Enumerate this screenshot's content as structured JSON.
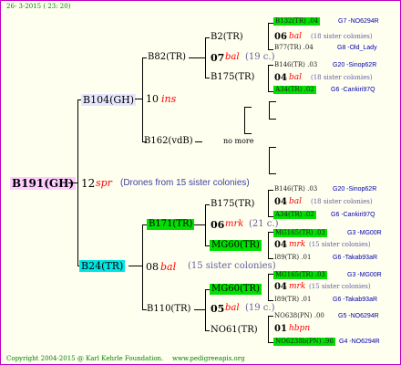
{
  "header": {
    "date": "26- 3-2015 ( 23: 20)"
  },
  "footer": {
    "copyright": "Copyright 2004-2015 @ Karl Kehrle Foundation.",
    "url": "www.pedigreeapis.org"
  },
  "root": {
    "name": "B191(GH)",
    "num": "12",
    "code": "spr",
    "note": "(Drones from 15 sister colonies)"
  },
  "sire": {
    "name": "B104(GH)",
    "num": "10",
    "code": "ins"
  },
  "sire_sire": {
    "name": "B82(TR)"
  },
  "b2": {
    "name": "B2(TR)",
    "num": "07",
    "code": "bal",
    "note": "(19 c.)"
  },
  "b175a": {
    "name": "B175(TR)"
  },
  "b162": {
    "name": "B162(vdB)",
    "note": "no more"
  },
  "dam": {
    "name": "B24(TR)",
    "num": "08",
    "code": "bal",
    "note": "(15 sister colonies)"
  },
  "b171": {
    "name": "B171(TR)"
  },
  "b175b": {
    "name": "B175(TR)",
    "num": "06",
    "code": "mrk",
    "note": "(21 c.)"
  },
  "mg60a": {
    "name": "MG60(TR)"
  },
  "b110": {
    "name": "B110(TR)"
  },
  "mg60b": {
    "name": "MG60(TR)",
    "num": "05",
    "code": "bal",
    "note": "(19 c.)"
  },
  "no61": {
    "name": "NO61(TR)"
  },
  "right": [
    {
      "a": "B132(TR) .04",
      "b": "G7 -NO6294R"
    },
    {
      "num": "06",
      "code": "bal",
      "note": "(18 sister colonies)"
    },
    {
      "a": "B77(TR) .04",
      "b": "G8 -Old_Lady"
    },
    {
      "a": "B146(TR) .03",
      "b": "G20 -Sinop62R"
    },
    {
      "num": "04",
      "code": "bal",
      "note": "(18 sister colonies)"
    },
    {
      "a": "A34(TR) .02",
      "b": "G6 -Cankiri97Q"
    },
    {
      "a": "B146(TR) .03",
      "b": "G20 -Sinop62R"
    },
    {
      "num": "04",
      "code": "bal",
      "note": "(18 sister colonies)"
    },
    {
      "a": "A34(TR) .02",
      "b": "G6 -Cankiri97Q"
    },
    {
      "a": "MG165(TR) .03",
      "b": "G3 -MG00R"
    },
    {
      "num": "04",
      "code": "mrk",
      "note": "(15 sister colonies)"
    },
    {
      "a": "I89(TR) .01",
      "b": "G6 -Takab93aR"
    },
    {
      "a": "MG165(TR) .03",
      "b": "G3 -MG00R"
    },
    {
      "num": "04",
      "code": "mrk",
      "note": "(15 sister colonies)"
    },
    {
      "a": "I89(TR) .01",
      "b": "G6 -Takab93aR"
    },
    {
      "a": "NO638(PN) .00",
      "b": "G5 -NO6294R"
    },
    {
      "num": "01",
      "code": "hbpn"
    },
    {
      "a": "NO6238b(PN) .96",
      "b": "G4 -NO6294R"
    }
  ]
}
